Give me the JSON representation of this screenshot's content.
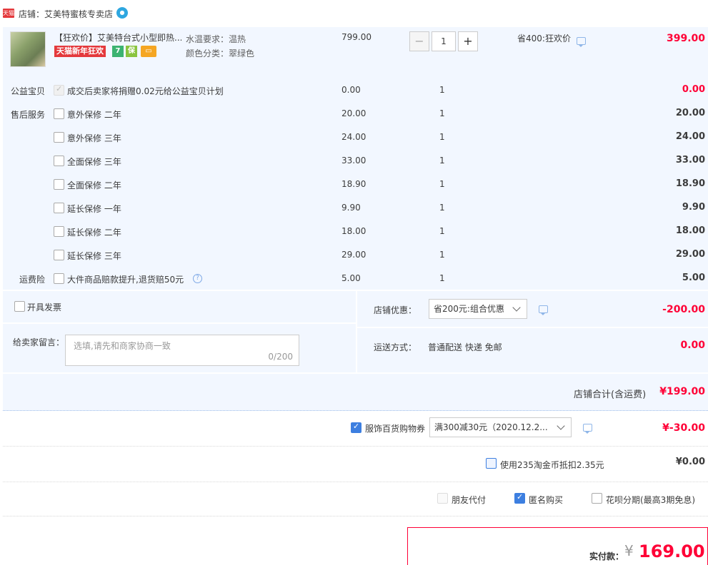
{
  "shop": {
    "badge": "天猫",
    "name": "店铺：艾美特蜜核专卖店"
  },
  "item": {
    "title": "【狂欢价】艾美特台式小型即热...",
    "promo_tag": "天猫新年狂欢",
    "sku_water_label": "水温要求：",
    "sku_water_value": "温热",
    "sku_color_label": "颜色分类：",
    "sku_color_value": "翠绿色",
    "unit_price": "799.00",
    "quantity": "1",
    "saving": "省400:狂欢价",
    "total": "399.00"
  },
  "services": [
    {
      "section": "公益宝贝",
      "name": "成交后卖家将捐赠0.02元给公益宝贝计划",
      "price": "0.00",
      "qty": "1",
      "total": "0.00",
      "red": true,
      "state": "checked-dis"
    },
    {
      "section": "售后服务",
      "name": "意外保修 二年",
      "price": "20.00",
      "qty": "1",
      "total": "20.00",
      "red": false,
      "state": ""
    },
    {
      "section": "",
      "name": "意外保修 三年",
      "price": "24.00",
      "qty": "1",
      "total": "24.00",
      "red": false,
      "state": ""
    },
    {
      "section": "",
      "name": "全面保修 三年",
      "price": "33.00",
      "qty": "1",
      "total": "33.00",
      "red": false,
      "state": ""
    },
    {
      "section": "",
      "name": "全面保修 二年",
      "price": "18.90",
      "qty": "1",
      "total": "18.90",
      "red": false,
      "state": ""
    },
    {
      "section": "",
      "name": "延长保修 一年",
      "price": "9.90",
      "qty": "1",
      "total": "9.90",
      "red": false,
      "state": ""
    },
    {
      "section": "",
      "name": "延长保修 二年",
      "price": "18.00",
      "qty": "1",
      "total": "18.00",
      "red": false,
      "state": ""
    },
    {
      "section": "",
      "name": "延长保修 三年",
      "price": "29.00",
      "qty": "1",
      "total": "29.00",
      "red": false,
      "state": ""
    },
    {
      "section": "运费险",
      "name": "大件商品赔款提升,退货赔50元",
      "price": "5.00",
      "qty": "1",
      "total": "5.00",
      "red": false,
      "state": ""
    }
  ],
  "extras": {
    "invoice_label": "开具发票",
    "message_label": "给卖家留言：",
    "message_placeholder": "选填,请先和商家协商一致",
    "message_count": "0/200",
    "shop_discount_label": "店铺优惠：",
    "shop_discount_value": "省200元:组合优惠",
    "shop_discount_amount": "-200.00",
    "shipping_label": "运送方式：",
    "shipping_value": "普通配送 快递 免邮",
    "shipping_amount": "0.00",
    "shop_total_label": "店铺合计(含运费)",
    "shop_total_value": "¥199.00"
  },
  "coupon": {
    "label": "服饰百货购物券",
    "value": "满300减30元（2020.12.2...",
    "amount": "¥-30.00"
  },
  "taobao_coins": {
    "label": "使用235淘金币抵扣2.35元",
    "amount": "¥0.00"
  },
  "options": {
    "friend_pay": "朋友代付",
    "anonymous": "匿名购买",
    "huabei": "花呗分期(最高3期免息)"
  },
  "payment": {
    "label": "实付款：",
    "currency": "¥",
    "amount": "169.00"
  },
  "colors": {
    "accent_red": "#ff0036",
    "checkbox_blue": "#3d7fe0",
    "panel_bg": "#f2f7ff"
  }
}
